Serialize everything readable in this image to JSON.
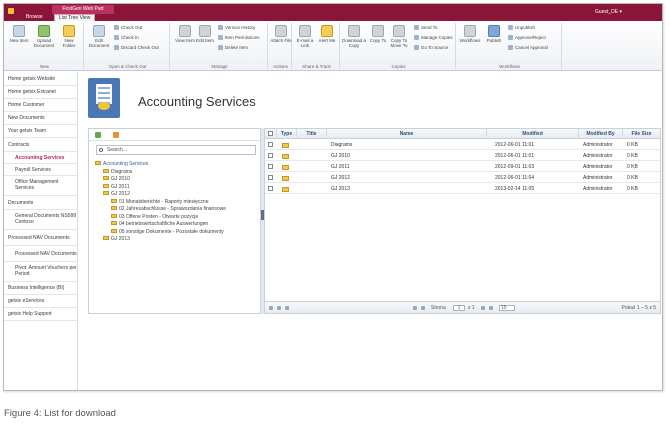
{
  "topbar": {
    "context_tab": "FirstGen Web Part",
    "tabs": [
      "Browse",
      "List Tree View"
    ],
    "user": "Guest_DE ▾"
  },
  "ribbon": {
    "groups": [
      {
        "label": "New",
        "big": [
          "New Item",
          "Upload Document",
          "New Folder"
        ]
      },
      {
        "label": "Open & Check Out",
        "big": [
          "Edit Document"
        ],
        "small": [
          "Check Out",
          "Check In",
          "Discard Check Out"
        ]
      },
      {
        "label": "Manage",
        "big": [
          "View Item",
          "Edit Item"
        ],
        "small": [
          "Version History",
          "Item Permissions",
          "Delete Item"
        ]
      },
      {
        "label": "Actions",
        "big": [
          "Attach File"
        ]
      },
      {
        "label": "Share & Track",
        "big": [
          "E-mail a Link",
          "Alert Me"
        ]
      },
      {
        "label": "Copies",
        "big": [
          "Download a Copy",
          "Copy To",
          "Copy To Move To"
        ],
        "small": [
          "Send To",
          "Manage Copies",
          "Go To Source"
        ]
      },
      {
        "label": "Workflows",
        "big": [
          "Workflows",
          "Publish"
        ],
        "small": [
          "Unpublish",
          "Approve/Reject",
          "Cancel Approval"
        ]
      }
    ]
  },
  "leftnav": {
    "items": [
      {
        "label": "Home getsix Website",
        "selected": false,
        "sub": false
      },
      {
        "label": "Home getsix Extranet",
        "selected": false,
        "sub": false
      },
      {
        "label": "Home Customer",
        "selected": false,
        "sub": false
      },
      {
        "label": "New Documents",
        "selected": false,
        "sub": false
      },
      {
        "label": "Your getsix Team",
        "selected": false,
        "sub": false
      },
      {
        "label": "Contracts",
        "selected": false,
        "sub": false
      },
      {
        "label": "Accounting Services",
        "selected": true,
        "sub": true
      },
      {
        "label": "Payroll Services",
        "selected": false,
        "sub": true
      },
      {
        "label": "Office Management Services",
        "selected": false,
        "sub": true
      },
      {
        "label": "Documents",
        "selected": false,
        "sub": false
      },
      {
        "label": "General Documents NS999 Contoso",
        "selected": false,
        "sub": true
      },
      {
        "label": "Processed NAV Documents",
        "selected": false,
        "sub": false
      },
      {
        "label": "Processed NAV Documents",
        "selected": false,
        "sub": true
      },
      {
        "label": "Pivot: Amount Vouchers per Period",
        "selected": false,
        "sub": true
      },
      {
        "label": "Business Intelligence (BI)",
        "selected": false,
        "sub": false
      },
      {
        "label": "getsix eServices",
        "selected": false,
        "sub": false
      },
      {
        "label": "getsix Help Support",
        "selected": false,
        "sub": false
      }
    ]
  },
  "page": {
    "title": "Accounting Services"
  },
  "tree": {
    "search_placeholder": "Search...",
    "nodes": [
      {
        "label": "Accounting Services",
        "level": 0
      },
      {
        "label": "Diagrams",
        "level": 1
      },
      {
        "label": "GJ 2010",
        "level": 1
      },
      {
        "label": "GJ 2011",
        "level": 1
      },
      {
        "label": "GJ 2012",
        "level": 1
      },
      {
        "label": "01 Monatsberichte - Raporty miesięczne",
        "level": 2
      },
      {
        "label": "02 Jahresabschlüsse - Sprawozdania finansowe",
        "level": 2
      },
      {
        "label": "03 Offene Posten - Otwarte pozycje",
        "level": 2
      },
      {
        "label": "04 betriebswirtschaftliche Auswertungen",
        "level": 2
      },
      {
        "label": "05 sonstige Dokumente - Pozostałe dokumenty",
        "level": 2
      },
      {
        "label": "GJ 2013",
        "level": 1
      }
    ]
  },
  "grid": {
    "columns": [
      "Type",
      "Title",
      "Name",
      "Modified",
      "Modified By",
      "File Size"
    ],
    "rows": [
      {
        "name": "Diagrams",
        "modified": "2012-06-01 11:01",
        "by": "Administrator",
        "size": "0 KB"
      },
      {
        "name": "GJ 2010",
        "modified": "2012-06-01 11:01",
        "by": "Administrator",
        "size": "0 KB"
      },
      {
        "name": "GJ 2011",
        "modified": "2012-09-01 11:03",
        "by": "Administrator",
        "size": "0 KB"
      },
      {
        "name": "GJ 2012",
        "modified": "2012-06-01 11:04",
        "by": "Administrator",
        "size": "0 KB"
      },
      {
        "name": "GJ 2013",
        "modified": "2013-02-14 11:05",
        "by": "Administrator",
        "size": "0 KB"
      }
    ],
    "pager": {
      "page_label": "Strona",
      "page": "1",
      "of": "z 1",
      "size": "15",
      "summary": "Pokaż 1 – 5 z 5"
    }
  },
  "caption": "Figure 4: List for download"
}
